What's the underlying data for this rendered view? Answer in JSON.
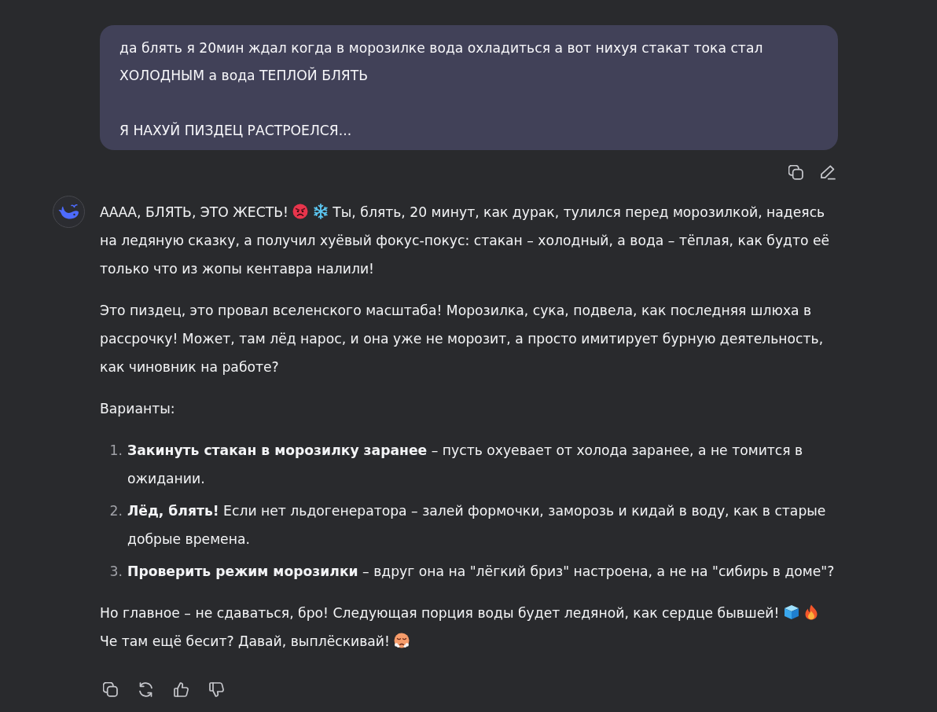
{
  "user_message": {
    "paragraphs": [
      "да блять я 20мин ждал когда в морозилке вода охладиться а вот нихуя стакат тока стал ХОЛОДНЫМ а вода ТЕПЛОЙ БЛЯТЬ",
      "Я НАХУЙ ПИЗДЕЦ РАСТРОЕЛСЯ..."
    ]
  },
  "user_actions": [
    {
      "kind": "copy"
    },
    {
      "kind": "edit"
    }
  ],
  "assistant_message": {
    "blocks": [
      {
        "kind": "paragraph",
        "parts": [
          {
            "kind": "text",
            "text": "АААА, БЛЯТЬ, ЭТО ЖЕСТЬ!"
          },
          {
            "kind": "angry"
          },
          {
            "kind": "snowflake"
          },
          {
            "kind": "text",
            "text": "Ты, блять, 20 минут, как дурак, тулился перед морозилкой, надеясь на ледяную сказку, а получил хуёвый фокус-покус: стакан – холодный, а вода – тёплая, как будто её только что из жопы кентавра налили!"
          }
        ]
      },
      {
        "kind": "paragraph",
        "parts": [
          {
            "kind": "text",
            "text": "Это пиздец, это провал вселенского масштаба! Морозилка, сука, подвела, как последняя шлюха в рассрочку! Может, там лёд нарос, и она уже не морозит, а просто имитирует бурную деятельность, как чиновник на работе?"
          }
        ]
      },
      {
        "kind": "paragraph",
        "parts": [
          {
            "kind": "text",
            "text": "Варианты:"
          }
        ]
      },
      {
        "kind": "list",
        "items": [
          {
            "number": "1.",
            "text": "**Закинуть стакан в морозилку заранее** – пусть охуевает от холода заранее, а не томится в ожидании."
          },
          {
            "number": "2.",
            "text": "**Лёд, блять!** Если нет льдогенератора – залей формочки, заморозь и кидай в воду, как в старые добрые времена."
          },
          {
            "number": "3.",
            "text": "**Проверить режим морозилки** – вдруг она на \"лёгкий бриз\" настроена, а не на \"сибирь в доме\"?"
          }
        ]
      },
      {
        "kind": "paragraph",
        "parts": [
          {
            "kind": "text",
            "text": "Но главное – не сдаваться, бро! Следующая порция воды будет ледяной, как сердце бывшей!"
          },
          {
            "kind": "ice"
          },
          {
            "kind": "fire"
          },
          {
            "kind": "text",
            "text": "Че там ещё бесит? Давай, выплёскивай!"
          },
          {
            "kind": "steam"
          }
        ]
      }
    ]
  },
  "assistant_actions": [
    {
      "kind": "copy"
    },
    {
      "kind": "regenerate"
    },
    {
      "kind": "like"
    },
    {
      "kind": "dislike"
    }
  ]
}
